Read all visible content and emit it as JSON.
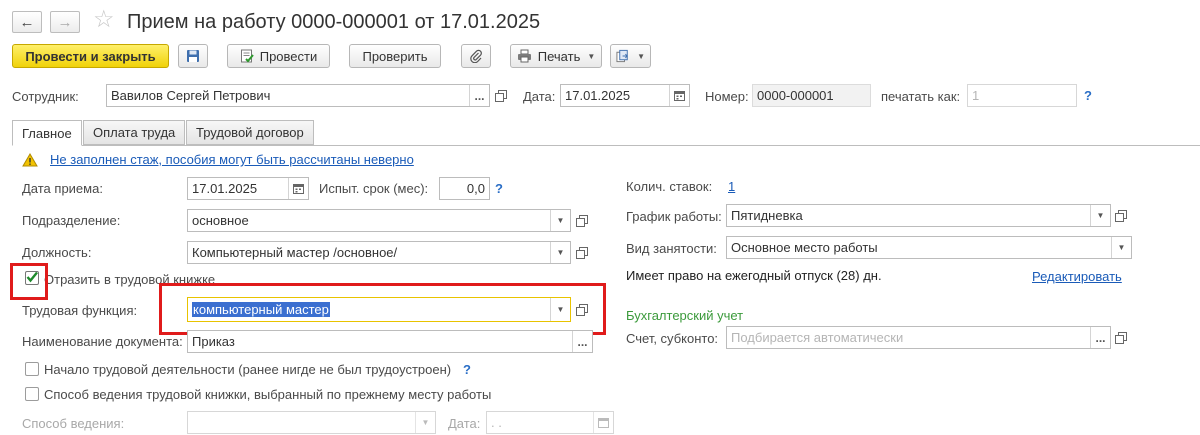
{
  "window": {
    "title": "Прием на работу 0000-000001 от 17.01.2025",
    "back_label": "←",
    "forward_label": "→"
  },
  "toolbar": {
    "post_close": "Провести и закрыть",
    "post": "Провести",
    "check": "Проверить",
    "print": "Печать"
  },
  "header": {
    "employee_label": "Сотрудник:",
    "employee_value": "Вавилов Сергей Петрович",
    "date_label": "Дата:",
    "date_value": "17.01.2025",
    "number_label": "Номер:",
    "number_value": "0000-000001",
    "print_as_label": "печатать как:",
    "print_as_value": "1",
    "help": "?"
  },
  "tabs": [
    "Главное",
    "Оплата труда",
    "Трудовой договор"
  ],
  "main": {
    "warning": "Не заполнен стаж, пособия могут быть рассчитаны неверно",
    "hire_date_label": "Дата приема:",
    "hire_date_value": "17.01.2025",
    "probation_label": "Испыт. срок (мес):",
    "probation_value": "0,0",
    "department_label": "Подразделение:",
    "department_value": "основное",
    "position_label": "Должность:",
    "position_value": "Компьютерный мастер /основное/",
    "reflect_label": "Отразить в трудовой книжке",
    "labor_function_label": "Трудовая функция:",
    "labor_function_value": "компьютерный мастер",
    "doc_name_label": "Наименование документа:",
    "doc_name_value": "Приказ",
    "start_activity_label": "Начало трудовой деятельности (ранее нигде не был трудоустроен)",
    "method_label": "Способ ведения трудовой книжки, выбранный по прежнему месту работы",
    "method_field_label": "Способ ведения:",
    "method_date_label": "Дата:",
    "method_date_value": " .  ."
  },
  "right": {
    "rates_label": "Колич. ставок:",
    "rates_value": "1",
    "schedule_label": "График работы:",
    "schedule_value": "Пятидневка",
    "employment_label": "Вид занятости:",
    "employment_value": "Основное место работы",
    "vacation_text": "Имеет право на ежегодный отпуск (28) дн.",
    "edit_link": "Редактировать",
    "accounting_header": "Бухгалтерский учет",
    "account_label": "Счет, субконто:",
    "account_placeholder": "Подбирается автоматически"
  },
  "colors": {
    "primary_button": "#f0d20a",
    "highlight_box": "#e01b1b",
    "link": "#1a5bb8",
    "accounting_header": "#3b9a3b",
    "selection": "#3b6fd0"
  }
}
